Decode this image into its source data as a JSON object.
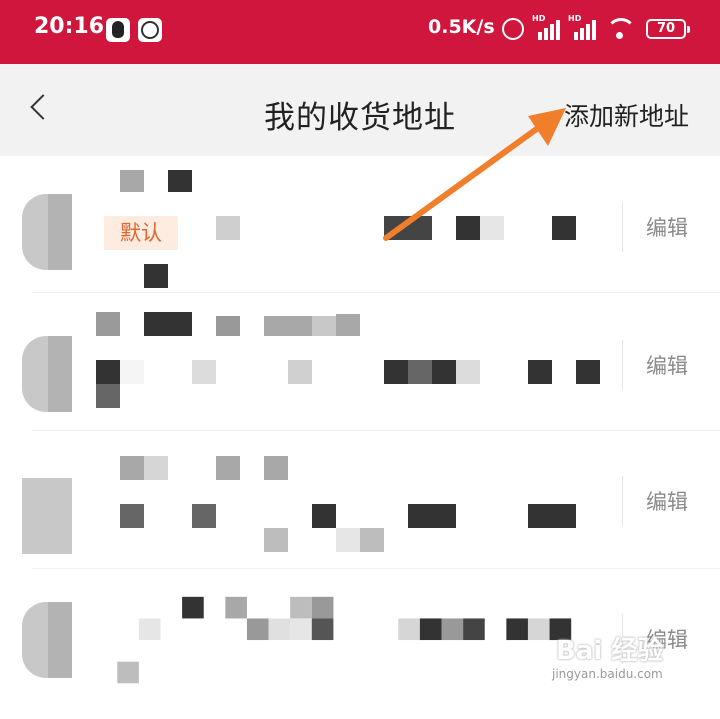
{
  "status_bar": {
    "time": "20:16",
    "network_speed": "0.5K/s",
    "signal1_label": "HD",
    "signal2_label": "HD",
    "battery": "70"
  },
  "nav": {
    "title": "我的收货地址",
    "add_address": "添加新地址"
  },
  "addresses": [
    {
      "default_tag": "默认",
      "edit_label": "编辑"
    },
    {
      "edit_label": "编辑"
    },
    {
      "edit_label": "编辑"
    },
    {
      "edit_label": "编辑"
    }
  ],
  "watermark": {
    "brand": "Bai 经验",
    "url": "jingyan.baidu.com"
  },
  "colors": {
    "status_bar": "#d0163c",
    "arrow": "#f07e2a",
    "default_tag_text": "#e2662e"
  },
  "icons": [
    "qq-icon",
    "clock-app-icon",
    "alarm-icon",
    "signal-icon",
    "wifi-icon",
    "battery-icon",
    "back-arrow-icon"
  ]
}
